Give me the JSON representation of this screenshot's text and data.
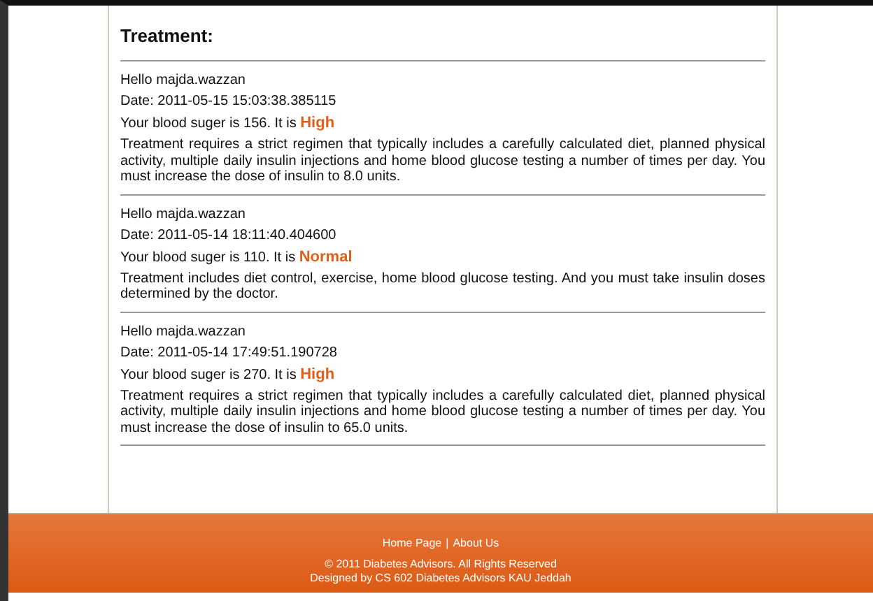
{
  "heading": "Treatment:",
  "records": [
    {
      "greeting": "Hello majda.wazzan",
      "date": "Date: 2011-05-15 15:03:38.385115",
      "sugar": "Your blood suger is 156. It is",
      "status": "High",
      "treatment": "Treatment requires a strict regimen that typically includes a carefully calculated diet, planned physical activity, multiple daily insulin injections and home blood glucose testing a number of times per day. You must increase the dose of insulin to 8.0 units."
    },
    {
      "greeting": "Hello majda.wazzan",
      "date": "Date: 2011-05-14 18:11:40.404600",
      "sugar": "Your blood suger is 110. It is",
      "status": "Normal",
      "treatment": "Treatment includes diet control, exercise, home blood glucose testing. And you must take insulin doses determined by the doctor."
    },
    {
      "greeting": "Hello majda.wazzan",
      "date": "Date: 2011-05-14 17:49:51.190728",
      "sugar": "Your blood suger is 270. It is",
      "status": "High",
      "treatment": "Treatment requires a strict regimen that typically includes a carefully calculated diet, planned physical activity, multiple daily insulin injections and home blood glucose testing a number of times per day. You must increase the dose of insulin to 65.0 units."
    }
  ],
  "footer": {
    "links": [
      "Home Page",
      "About Us"
    ],
    "separator": "|",
    "copyright": "© 2011 Diabetes Advisors. All Rights Reserved",
    "credit": "Designed by CS 602 Diabetes Advisors KAU Jeddah"
  }
}
